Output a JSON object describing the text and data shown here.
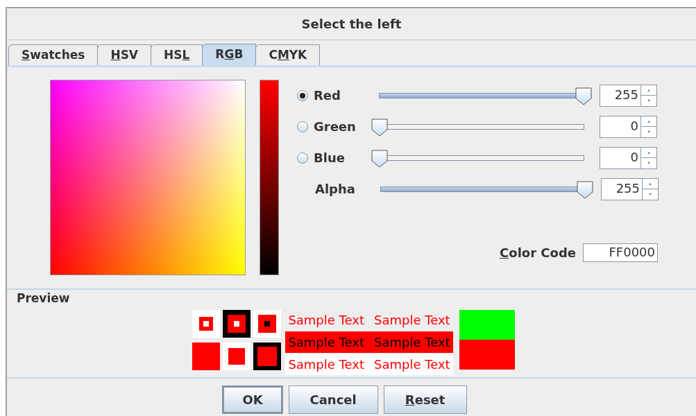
{
  "window": {
    "title": "Select the left"
  },
  "tabs": [
    {
      "label_parts": [
        {
          "text": "S",
          "underlined": true
        },
        {
          "text": "watches",
          "underlined": false
        }
      ],
      "selected": false
    },
    {
      "label_parts": [
        {
          "text": "H",
          "underlined": true
        },
        {
          "text": "SV",
          "underlined": false
        }
      ],
      "selected": false
    },
    {
      "label_parts": [
        {
          "text": "HS",
          "underlined": false
        },
        {
          "text": "L",
          "underlined": true
        }
      ],
      "selected": false
    },
    {
      "label_parts": [
        {
          "text": "R",
          "underlined": false
        },
        {
          "text": "G",
          "underlined": true
        },
        {
          "text": "B",
          "underlined": false
        }
      ],
      "selected": true
    },
    {
      "label_parts": [
        {
          "text": "C",
          "underlined": false
        },
        {
          "text": "M",
          "underlined": true
        },
        {
          "text": "YK",
          "underlined": false
        }
      ],
      "selected": false
    }
  ],
  "channels": [
    {
      "kind": "radio",
      "name": "Red",
      "selected": true,
      "level": 1,
      "value": "255"
    },
    {
      "kind": "radio",
      "name": "Green",
      "selected": false,
      "level": 0,
      "value": "0"
    },
    {
      "kind": "radio",
      "name": "Blue",
      "selected": false,
      "level": 0,
      "value": "0"
    },
    {
      "kind": "plain",
      "name": "Alpha",
      "level": 1,
      "value": "255"
    }
  ],
  "color_code": {
    "label_parts": [
      {
        "text": "C",
        "underlined": true
      },
      {
        "text": "olor Code",
        "underlined": false
      }
    ],
    "value": "FF0000"
  },
  "preview": {
    "title": "Preview",
    "swatches": [
      {
        "color": "#00ff00"
      },
      {
        "color": "#ff0000"
      }
    ],
    "sample_rows": [
      [
        "Sample Text",
        "Sample Text"
      ],
      [
        "Sample Text",
        "Sample Text"
      ],
      [
        "Sample Text",
        "Sample Text"
      ]
    ]
  },
  "buttons": [
    {
      "label_parts": [
        {
          "text": "OK",
          "underlined": false
        }
      ],
      "default": true
    },
    {
      "label_parts": [
        {
          "text": "Cancel",
          "underlined": false
        }
      ],
      "default": false
    },
    {
      "label_parts": [
        {
          "text": "R",
          "underlined": true
        },
        {
          "text": "eset",
          "underlined": false
        }
      ],
      "default": false
    }
  ]
}
